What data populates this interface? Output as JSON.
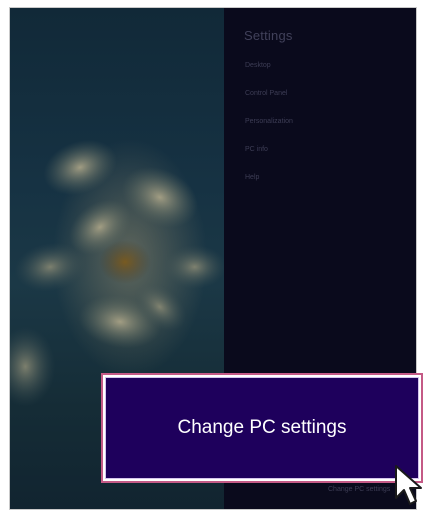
{
  "settings_pane": {
    "title": "Settings",
    "items": [
      {
        "label": "Desktop"
      },
      {
        "label": "Control Panel"
      },
      {
        "label": "Personalization"
      },
      {
        "label": "PC info"
      },
      {
        "label": "Help"
      }
    ],
    "footer_label": "Change PC settings"
  },
  "callout": {
    "button_label": "Change PC settings"
  },
  "icons": {
    "pointer": "mouse-pointer-icon"
  },
  "colors": {
    "charm_background": "#0a0a1c",
    "button_background": "#1e005c",
    "highlight_border": "#c45a86"
  }
}
